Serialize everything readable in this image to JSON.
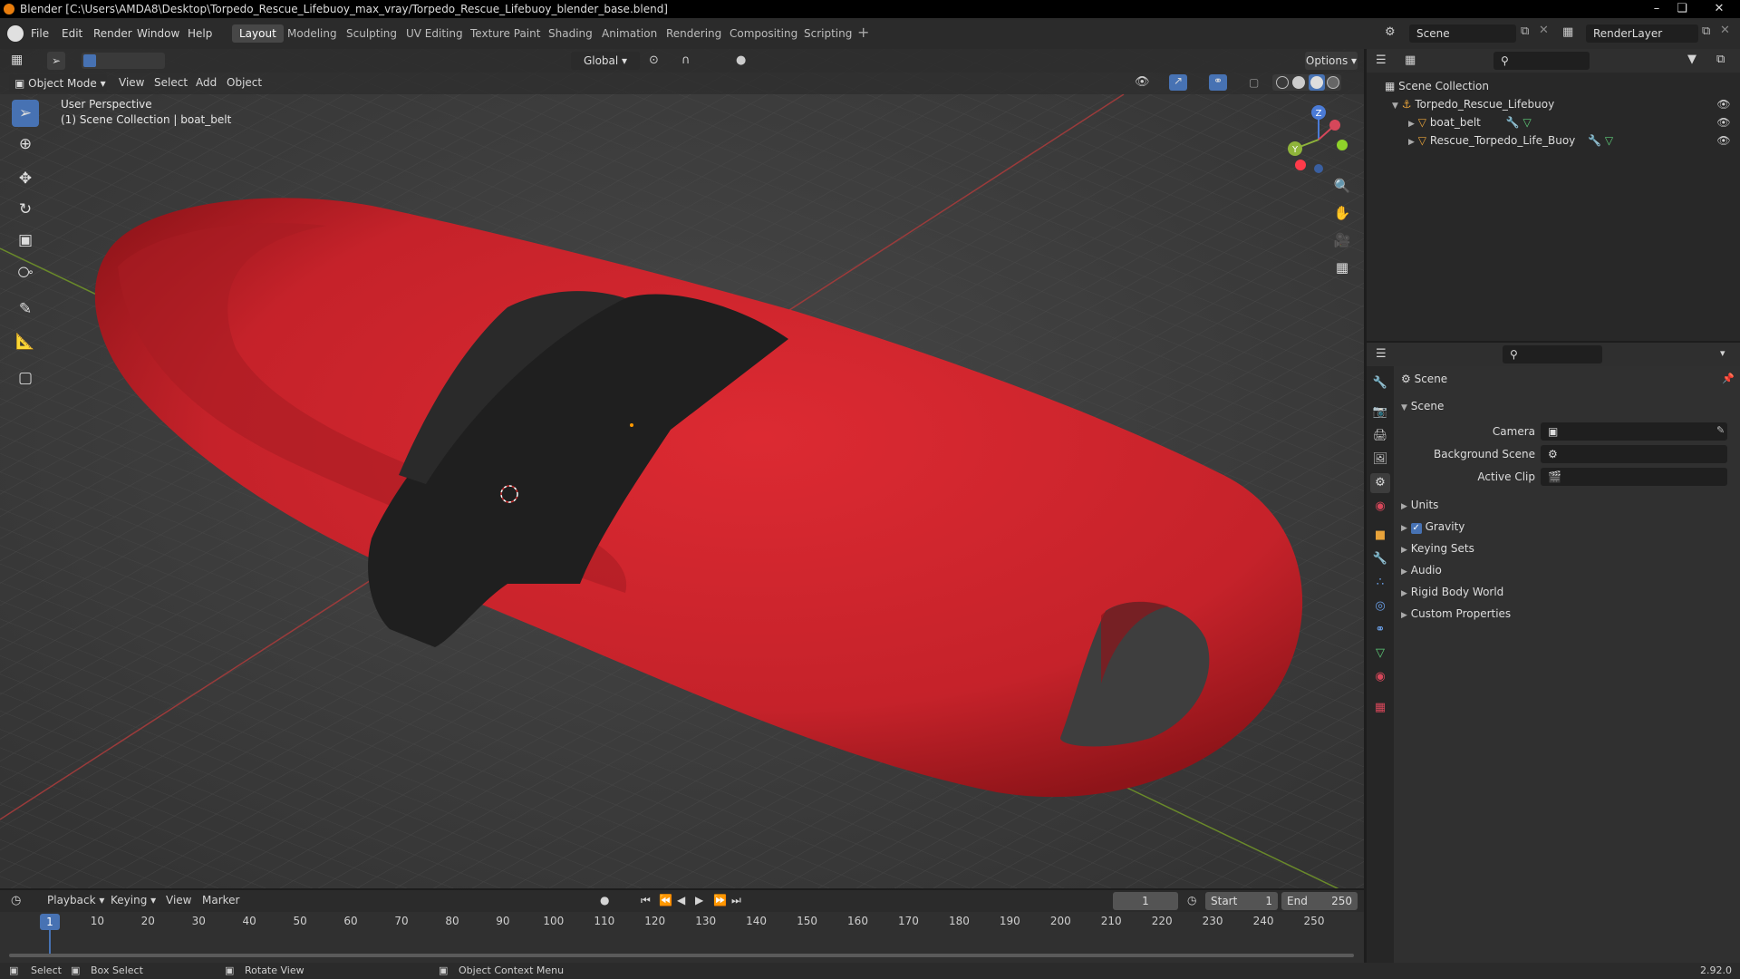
{
  "window": {
    "title": "Blender [C:\\Users\\AMDA8\\Desktop\\Torpedo_Rescue_Lifebuoy_max_vray/Torpedo_Rescue_Lifebuoy_blender_base.blend]"
  },
  "menu": {
    "file": "File",
    "edit": "Edit",
    "render": "Render",
    "window": "Window",
    "help": "Help"
  },
  "workspaces": [
    "Layout",
    "Modeling",
    "Sculpting",
    "UV Editing",
    "Texture Paint",
    "Shading",
    "Animation",
    "Rendering",
    "Compositing",
    "Scripting"
  ],
  "top_right": {
    "scene": "Scene",
    "render_layer": "RenderLayer"
  },
  "viewport_header": {
    "transform": "Global",
    "options": "Options",
    "mode": "Object Mode",
    "view": "View",
    "select": "Select",
    "add": "Add",
    "object": "Object"
  },
  "overlay_text": {
    "perspective": "User Perspective",
    "collection": "(1) Scene Collection | boat_belt"
  },
  "gizmo": {
    "x": "X",
    "y": "Y",
    "z": "Z"
  },
  "outliner": {
    "root": "Scene Collection",
    "collection": "Torpedo_Rescue_Lifebuoy",
    "objects": [
      "boat_belt",
      "Rescue_Torpedo_Life_Buoy"
    ]
  },
  "properties": {
    "title": "Scene",
    "panel": "Scene",
    "camera_label": "Camera",
    "background_scene_label": "Background Scene",
    "active_clip_label": "Active Clip",
    "sections": [
      "Units",
      "Gravity",
      "Keying Sets",
      "Audio",
      "Rigid Body World",
      "Custom Properties"
    ],
    "gravity_checked": true
  },
  "timeline": {
    "playback": "Playback",
    "keying": "Keying",
    "view": "View",
    "marker": "Marker",
    "current_frame": "1",
    "start_label": "Start",
    "start": "1",
    "end_label": "End",
    "end": "250",
    "ticks": [
      "1",
      "10",
      "20",
      "30",
      "40",
      "50",
      "60",
      "70",
      "80",
      "90",
      "100",
      "110",
      "120",
      "130",
      "140",
      "150",
      "160",
      "170",
      "180",
      "190",
      "200",
      "210",
      "220",
      "230",
      "240",
      "250"
    ]
  },
  "status": {
    "select": "Select",
    "box_select": "Box Select",
    "rotate_view": "Rotate View",
    "context_menu": "Object Context Menu",
    "version": "2.92.0"
  },
  "colors": {
    "accent": "#4772b3",
    "object_red": "#c9232c",
    "belt": "#1f1f1f"
  }
}
